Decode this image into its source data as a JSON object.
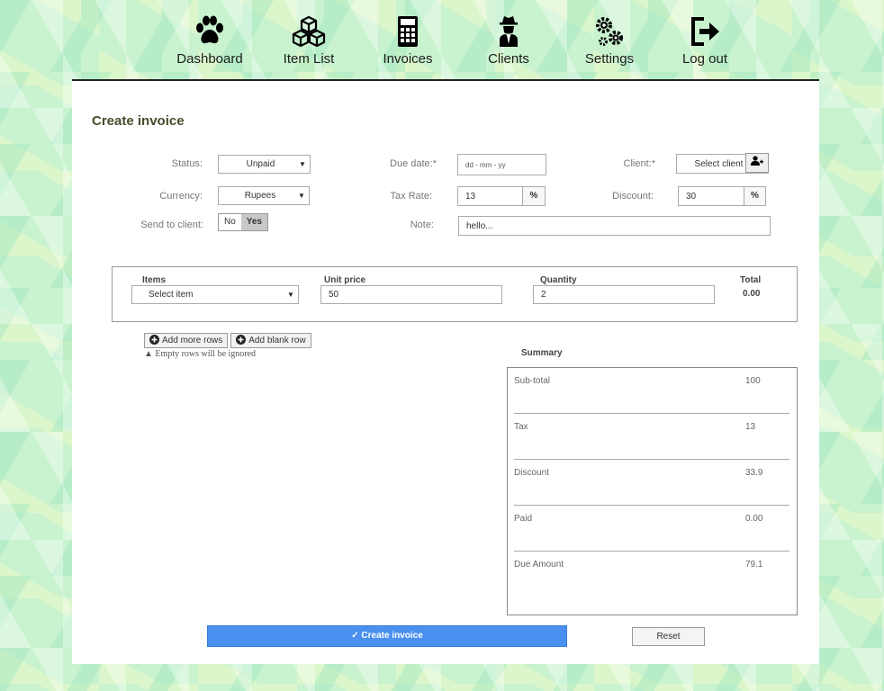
{
  "nav": {
    "items": [
      {
        "label": "Dashboard",
        "icon": "paw-icon"
      },
      {
        "label": "Item List",
        "icon": "cubes-icon"
      },
      {
        "label": "Invoices",
        "icon": "calculator-icon"
      },
      {
        "label": "Clients",
        "icon": "user-secret-icon"
      },
      {
        "label": "Settings",
        "icon": "cogs-icon"
      },
      {
        "label": "Log out",
        "icon": "sign-out-icon"
      }
    ]
  },
  "form": {
    "title": "Create invoice",
    "status": {
      "label": "Status:",
      "value": "Unpaid"
    },
    "due_date": {
      "label": "Due date:*",
      "placeholder": "dd - mm - yy"
    },
    "client": {
      "label": "Client:*",
      "value": "Select client"
    },
    "currency": {
      "label": "Currency:",
      "value": "Rupees"
    },
    "tax_rate": {
      "label": "Tax Rate:",
      "value": "13",
      "unit": "%"
    },
    "discount": {
      "label": "Discount:",
      "value": "30",
      "unit": "%"
    },
    "send_to_client": {
      "label": "Send to client:",
      "no": "No",
      "yes": "Yes",
      "selected": "Yes"
    },
    "note": {
      "label": "Note:",
      "value": "hello..."
    }
  },
  "items_table": {
    "headers": {
      "items": "Items",
      "unit_price": "Unit price",
      "quantity": "Quantity",
      "total": "Total"
    },
    "row": {
      "item": "Select item",
      "unit_price": "50",
      "quantity": "2",
      "total": "0.00"
    }
  },
  "row_actions": {
    "add_more": "Add more rows",
    "add_blank": "Add blank row",
    "warning": "Empty rows will be ignored"
  },
  "summary": {
    "title": "Summary",
    "rows": [
      {
        "label": "Sub-total",
        "value": "100"
      },
      {
        "label": "Tax",
        "value": "13"
      },
      {
        "label": "Discount",
        "value": "33.9"
      },
      {
        "label": "Paid",
        "value": "0.00"
      },
      {
        "label": "Due Amount",
        "value": "79.1"
      }
    ]
  },
  "actions": {
    "create": "✓ Create invoice",
    "reset": "Reset"
  },
  "colors": {
    "primary_button": "#4a90f0",
    "background": "#c9f2cf"
  }
}
